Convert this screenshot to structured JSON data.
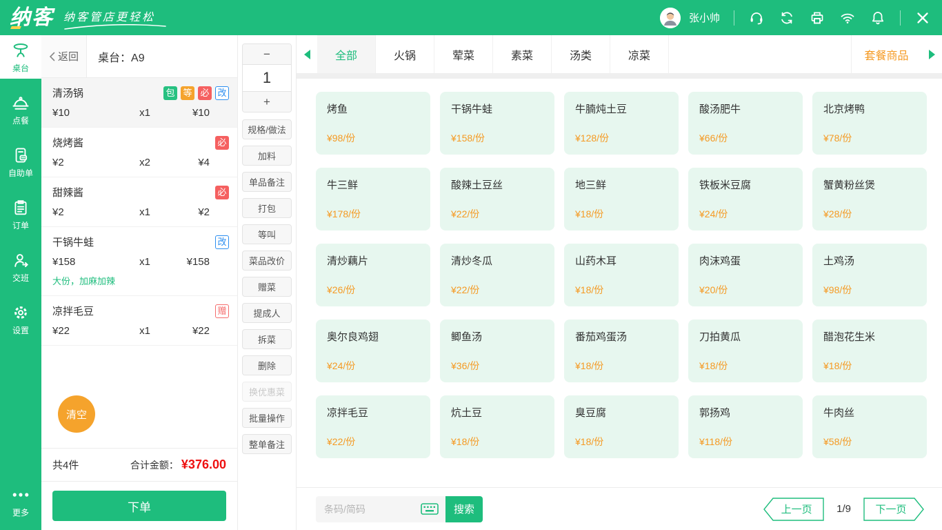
{
  "topbar": {
    "logo_text": "纳客",
    "slogan": "纳客管店更轻松",
    "user_name": "张小帅",
    "icons": [
      "support-icon",
      "sync-icon",
      "printer-icon",
      "wifi-icon",
      "bell-icon",
      "close-icon"
    ]
  },
  "sidebar": {
    "items": [
      {
        "label": "桌台",
        "icon": "table-icon",
        "active": true
      },
      {
        "label": "点餐",
        "icon": "cloche-icon"
      },
      {
        "label": "自助单",
        "icon": "self-order-icon"
      },
      {
        "label": "订单",
        "icon": "clipboard-icon"
      },
      {
        "label": "交班",
        "icon": "shift-person-icon"
      },
      {
        "label": "设置",
        "icon": "gear-icon"
      }
    ],
    "more_label": "更多",
    "more_icon": "ellipsis-icon"
  },
  "order_panel": {
    "back_label": "返回",
    "table_label": "桌台：",
    "table_value": "A9",
    "items": [
      {
        "name": "清汤锅",
        "unit_price": "¥10",
        "qty": "x1",
        "total": "¥10",
        "selected": true,
        "badges": [
          {
            "text": "包"
          },
          {
            "text": "等"
          },
          {
            "text": "必"
          },
          {
            "text": "改"
          }
        ]
      },
      {
        "name": "烧烤酱",
        "unit_price": "¥2",
        "qty": "x2",
        "total": "¥4",
        "badges": [
          {
            "text": "必"
          }
        ]
      },
      {
        "name": "甜辣酱",
        "unit_price": "¥2",
        "qty": "x1",
        "total": "¥2",
        "badges": [
          {
            "text": "必"
          }
        ]
      },
      {
        "name": "干锅牛蛙",
        "unit_price": "¥158",
        "qty": "x1",
        "total": "¥158",
        "badges": [
          {
            "text": "改"
          }
        ],
        "note": "大份，加麻加辣"
      },
      {
        "name": "凉拌毛豆",
        "unit_price": "¥22",
        "qty": "x1",
        "total": "¥22",
        "badges": [
          {
            "text": "赠"
          }
        ]
      }
    ],
    "clear_label": "清空",
    "summary_count": "共4件",
    "summary_label": "合计金额：",
    "summary_amount": "¥376.00",
    "submit_label": "下单"
  },
  "actions": {
    "stepper": {
      "decrease_label": "−",
      "value": "1",
      "increase_label": "+"
    },
    "buttons": [
      {
        "label": "规格/做法"
      },
      {
        "label": "加料"
      },
      {
        "label": "单品备注"
      },
      {
        "label": "打包"
      },
      {
        "label": "等叫"
      },
      {
        "label": "菜品改价"
      },
      {
        "label": "赠菜"
      },
      {
        "label": "提成人"
      },
      {
        "label": "拆菜"
      },
      {
        "label": "删除"
      },
      {
        "label": "换优惠菜",
        "disabled": true
      },
      {
        "label": "批量操作"
      },
      {
        "label": "整单备注"
      }
    ]
  },
  "categories": {
    "tabs": [
      {
        "label": "全部",
        "active": true
      },
      {
        "label": "火锅"
      },
      {
        "label": "荤菜"
      },
      {
        "label": "素菜"
      },
      {
        "label": "汤类"
      },
      {
        "label": "凉菜"
      }
    ],
    "combo_label": "套餐商品"
  },
  "menu": {
    "items": [
      {
        "name": "烤鱼",
        "price": "¥98/份"
      },
      {
        "name": "干锅牛蛙",
        "price": "¥158/份"
      },
      {
        "name": "牛腩炖土豆",
        "price": "¥128/份"
      },
      {
        "name": "酸汤肥牛",
        "price": "¥66/份"
      },
      {
        "name": "北京烤鸭",
        "price": "¥78/份"
      },
      {
        "name": "牛三鲜",
        "price": "¥178/份"
      },
      {
        "name": "酸辣土豆丝",
        "price": "¥22/份"
      },
      {
        "name": "地三鲜",
        "price": "¥18/份"
      },
      {
        "name": "铁板米豆腐",
        "price": "¥24/份"
      },
      {
        "name": "蟹黄粉丝煲",
        "price": "¥28/份"
      },
      {
        "name": "清炒藕片",
        "price": "¥26/份"
      },
      {
        "name": "清炒冬瓜",
        "price": "¥22/份"
      },
      {
        "name": "山药木耳",
        "price": "¥18/份"
      },
      {
        "name": "肉沫鸡蛋",
        "price": "¥20/份"
      },
      {
        "name": "土鸡汤",
        "price": "¥98/份"
      },
      {
        "name": "奥尔良鸡翅",
        "price": "¥24/份"
      },
      {
        "name": "鲫鱼汤",
        "price": "¥36/份"
      },
      {
        "name": "番茄鸡蛋汤",
        "price": "¥18/份"
      },
      {
        "name": "刀拍黄瓜",
        "price": "¥18/份"
      },
      {
        "name": "醋泡花生米",
        "price": "¥18/份"
      },
      {
        "name": "凉拌毛豆",
        "price": "¥22/份"
      },
      {
        "name": "炕土豆",
        "price": "¥18/份"
      },
      {
        "name": "臭豆腐",
        "price": "¥18/份"
      },
      {
        "name": "郭扬鸡",
        "price": "¥118/份"
      },
      {
        "name": "牛肉丝",
        "price": "¥58/份"
      }
    ]
  },
  "footer": {
    "search_placeholder": "条码/简码",
    "keyboard_icon": "keyboard-icon",
    "search_label": "搜索",
    "prev_label": "上一页",
    "page_indicator": "1/9",
    "next_label": "下一页"
  },
  "colors": {
    "primary_green": "#1ebd7d",
    "card_bg": "#e7f7ef",
    "price_orange": "#f59a23",
    "badge_green": "#27c181",
    "badge_orange": "#f5a32c",
    "badge_red": "#f56060",
    "badge_blue": "#2b8ef0",
    "gift_red": "#f56c6c",
    "total_red": "#ee1010"
  }
}
